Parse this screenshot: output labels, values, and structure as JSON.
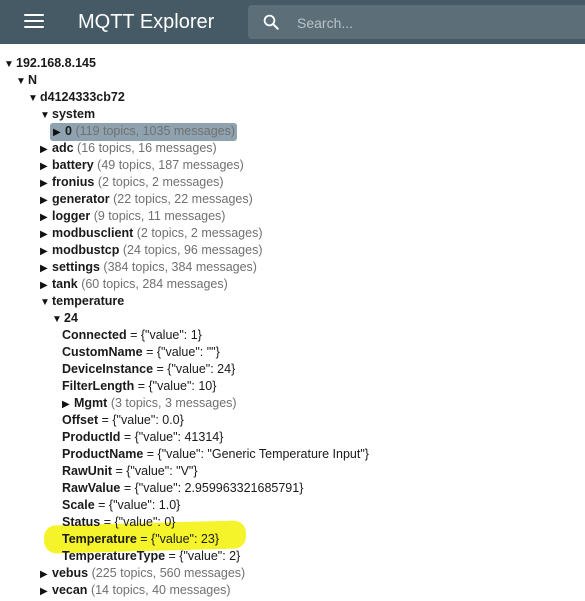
{
  "app": {
    "title": "MQTT Explorer",
    "menu_icon": "hamburger-menu-icon",
    "appbar_color": "#455a64"
  },
  "search": {
    "placeholder": "Search...",
    "value": "",
    "icon": "search-icon"
  },
  "highlight_color": "#f5f32a",
  "tree": {
    "rows": [
      {
        "expander": "▼",
        "key": "192.168.8.145",
        "suffix": "",
        "kind": "branch"
      },
      {
        "expander": "▼",
        "key": "N",
        "suffix": "",
        "kind": "branch"
      },
      {
        "expander": "▼",
        "key": "d4124333cb72",
        "suffix": "",
        "kind": "branch"
      },
      {
        "expander": "▼",
        "key": "system",
        "suffix": "",
        "kind": "branch"
      },
      {
        "expander": "▶",
        "key": "0",
        "suffix": "(119 topics, 1035 messages)",
        "kind": "selected"
      },
      {
        "expander": "▶",
        "key": "adc",
        "suffix": "(16 topics, 16 messages)",
        "kind": "branch"
      },
      {
        "expander": "▶",
        "key": "battery",
        "suffix": "(49 topics, 187 messages)",
        "kind": "branch"
      },
      {
        "expander": "▶",
        "key": "fronius",
        "suffix": "(2 topics, 2 messages)",
        "kind": "branch"
      },
      {
        "expander": "▶",
        "key": "generator",
        "suffix": "(22 topics, 22 messages)",
        "kind": "branch"
      },
      {
        "expander": "▶",
        "key": "logger",
        "suffix": "(9 topics, 11 messages)",
        "kind": "branch"
      },
      {
        "expander": "▶",
        "key": "modbusclient",
        "suffix": "(2 topics, 2 messages)",
        "kind": "branch"
      },
      {
        "expander": "▶",
        "key": "modbustcp",
        "suffix": "(24 topics, 96 messages)",
        "kind": "branch"
      },
      {
        "expander": "▶",
        "key": "settings",
        "suffix": "(384 topics, 384 messages)",
        "kind": "branch"
      },
      {
        "expander": "▶",
        "key": "tank",
        "suffix": "(60 topics, 284 messages)",
        "kind": "branch"
      },
      {
        "expander": "▼",
        "key": "temperature",
        "suffix": "",
        "kind": "branch"
      },
      {
        "expander": "▼",
        "key": "24",
        "suffix": "",
        "kind": "branch"
      },
      {
        "expander": "",
        "key": "Connected",
        "suffix": "= {\"value\": 1}",
        "kind": "leaf"
      },
      {
        "expander": "",
        "key": "CustomName",
        "suffix": "= {\"value\": \"\"}",
        "kind": "leaf"
      },
      {
        "expander": "",
        "key": "DeviceInstance",
        "suffix": "= {\"value\": 24}",
        "kind": "leaf"
      },
      {
        "expander": "",
        "key": "FilterLength",
        "suffix": "= {\"value\": 10}",
        "kind": "leaf"
      },
      {
        "expander": "▶",
        "key": "Mgmt",
        "suffix": "(3 topics, 3 messages)",
        "kind": "branch"
      },
      {
        "expander": "",
        "key": "Offset",
        "suffix": "= {\"value\": 0.0}",
        "kind": "leaf"
      },
      {
        "expander": "",
        "key": "ProductId",
        "suffix": "= {\"value\": 41314}",
        "kind": "leaf"
      },
      {
        "expander": "",
        "key": "ProductName",
        "suffix": "= {\"value\": \"Generic Temperature Input\"}",
        "kind": "leaf"
      },
      {
        "expander": "",
        "key": "RawUnit",
        "suffix": "= {\"value\": \"V\"}",
        "kind": "leaf"
      },
      {
        "expander": "",
        "key": "RawValue",
        "suffix": "= {\"value\": 2.959963321685791}",
        "kind": "leaf"
      },
      {
        "expander": "",
        "key": "Scale",
        "suffix": "= {\"value\": 1.0}",
        "kind": "leaf"
      },
      {
        "expander": "",
        "key": "Status",
        "suffix": "= {\"value\": 0}",
        "kind": "leaf"
      },
      {
        "expander": "",
        "key": "Temperature",
        "suffix": "= {\"value\": 23}",
        "kind": "leaf"
      },
      {
        "expander": "",
        "key": "TemperatureType",
        "suffix": "= {\"value\": 2}",
        "kind": "leaf"
      },
      {
        "expander": "▶",
        "key": "vebus",
        "suffix": "(225 topics, 560 messages)",
        "kind": "branch"
      },
      {
        "expander": "▶",
        "key": "vecan",
        "suffix": "(14 topics, 40 messages)",
        "kind": "branch"
      }
    ]
  }
}
